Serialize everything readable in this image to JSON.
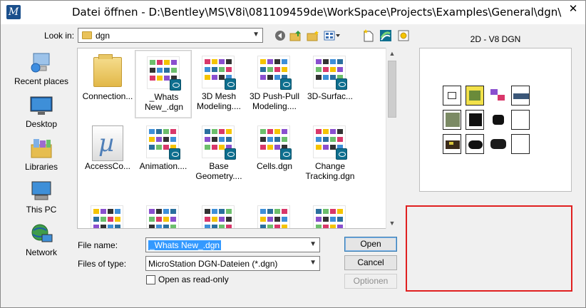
{
  "window": {
    "title": "Datei öffnen - D:\\Bentley\\MS\\V8i\\081109459de\\WorkSpace\\Projects\\Examples\\General\\dgn\\",
    "close_glyph": "✕"
  },
  "toolbar": {
    "look_in_label": "Look in:",
    "look_in_value": "dgn",
    "buttons": [
      "back-icon",
      "up-folder-icon",
      "new-folder-icon",
      "view-menu-icon",
      "new-file-icon",
      "workspace-icon",
      "preferences-icon"
    ]
  },
  "places": [
    {
      "label": "Recent places",
      "icon": "recent-places-icon"
    },
    {
      "label": "Desktop",
      "icon": "desktop-icon"
    },
    {
      "label": "Libraries",
      "icon": "libraries-icon"
    },
    {
      "label": "This PC",
      "icon": "this-pc-icon"
    },
    {
      "label": "Network",
      "icon": "network-icon"
    }
  ],
  "files": [
    {
      "label": "Connection...",
      "kind": "folder"
    },
    {
      "label": "_Whats New_.dgn",
      "kind": "dgn",
      "selected": true
    },
    {
      "label": "3D Mesh Modeling....",
      "kind": "dgn"
    },
    {
      "label": "3D Push-Pull Modeling....",
      "kind": "dgn"
    },
    {
      "label": "3D-Surfac...",
      "kind": "dgn"
    },
    {
      "label": "AccessCo...",
      "kind": "app"
    },
    {
      "label": "Animation....",
      "kind": "dgn"
    },
    {
      "label": "Base Geometry....",
      "kind": "dgn"
    },
    {
      "label": "Cells.dgn",
      "kind": "dgn"
    },
    {
      "label": "Change Tracking.dgn",
      "kind": "dgn"
    },
    {
      "label": "",
      "kind": "dgn"
    },
    {
      "label": "",
      "kind": "dgn"
    },
    {
      "label": "",
      "kind": "dgn"
    },
    {
      "label": "",
      "kind": "dgn"
    },
    {
      "label": "",
      "kind": "dgn"
    }
  ],
  "form": {
    "file_name_label": "File name:",
    "file_name_value": "_Whats New_.dgn",
    "file_type_label": "Files of type:",
    "file_type_value": "MicroStation DGN-Dateien (*.dgn)",
    "read_only_label": "Open as read-only",
    "read_only_checked": false
  },
  "buttons": {
    "open": "Open",
    "cancel": "Cancel",
    "options": "Optionen"
  },
  "preview": {
    "title": "2D - V8 DGN"
  },
  "colors": {
    "accent": "#3399ff",
    "highlight_frame": "#e02020",
    "dgn_badge": "#0e6f8f"
  }
}
